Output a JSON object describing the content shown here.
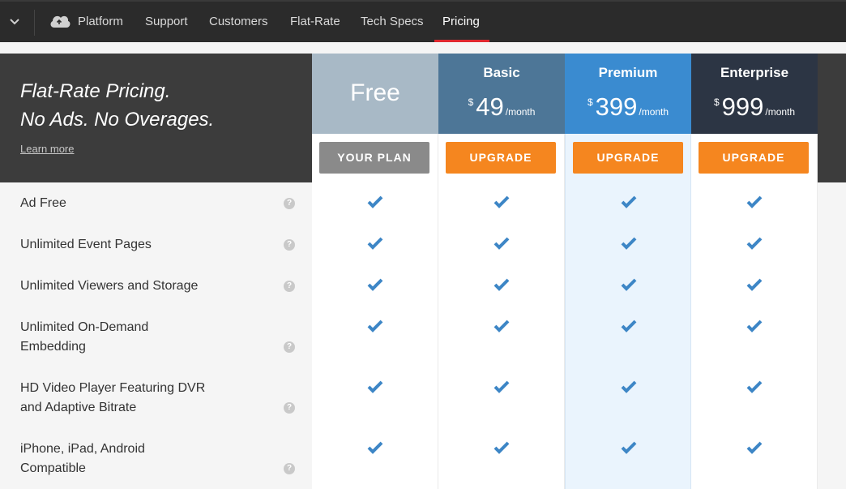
{
  "nav": {
    "items": [
      "Platform",
      "Support",
      "Customers",
      "Flat-Rate",
      "Tech Specs",
      "Pricing"
    ],
    "active": "Pricing",
    "logo_icon": "cloud-icon",
    "toggle_icon": "chevron-down-icon"
  },
  "hero": {
    "title": "Flat-Rate Pricing.\nNo Ads. No Overages.",
    "link": "Learn more"
  },
  "plans": [
    {
      "name": "Free",
      "currency": "",
      "price": "",
      "period": "",
      "button": "YOUR PLAN",
      "color": "#a8b9c6"
    },
    {
      "name": "Basic",
      "currency": "$",
      "price": "49",
      "period": "/month",
      "button": "UPGRADE",
      "color": "#4d7697"
    },
    {
      "name": "Premium",
      "currency": "$",
      "price": "399",
      "period": "/month",
      "button": "UPGRADE",
      "color": "#3a8bd0"
    },
    {
      "name": "Enterprise",
      "currency": "$",
      "price": "999",
      "period": "/month",
      "button": "UPGRADE",
      "color": "#2c3544"
    }
  ],
  "features": [
    {
      "label": "Ad Free",
      "included": [
        true,
        true,
        true,
        true
      ]
    },
    {
      "label": "Unlimited Event Pages",
      "included": [
        true,
        true,
        true,
        true
      ]
    },
    {
      "label": "Unlimited Viewers and Storage",
      "included": [
        true,
        true,
        true,
        true
      ]
    },
    {
      "label": "Unlimited On-Demand Embedding",
      "included": [
        true,
        true,
        true,
        true
      ]
    },
    {
      "label": "HD Video Player Featuring DVR and Adaptive Bitrate",
      "included": [
        true,
        true,
        true,
        true
      ]
    },
    {
      "label": "iPhone, iPad, Android Compatible",
      "included": [
        true,
        true,
        true,
        true
      ]
    }
  ],
  "colors": {
    "check": "#3d86c6",
    "premium_highlight": "#eaf4fd",
    "accent_red": "#e0282f",
    "button_orange": "#f5861f"
  }
}
